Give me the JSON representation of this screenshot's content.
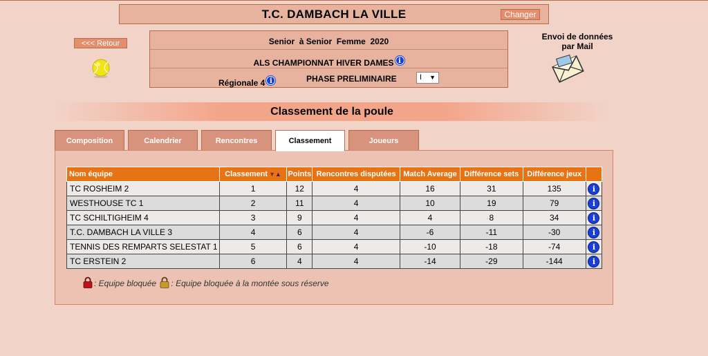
{
  "header": {
    "club_name": "T.C. DAMBACH LA VILLE",
    "change_label": "Changer"
  },
  "nav": {
    "back_label": "<<< Retour"
  },
  "competition": {
    "category": "Senior  à Senior  Femme  2020",
    "championship": "ALS CHAMPIONNAT HIVER DAMES",
    "division": "Régionale 4",
    "phase": "PHASE PRELIMINAIRE",
    "phase_selected": "I"
  },
  "mail": {
    "label_line1": "Envoi de données",
    "label_line2": "par Mail"
  },
  "section": {
    "title": "Classement de la poule"
  },
  "tabs": [
    {
      "label": "Composition",
      "active": false
    },
    {
      "label": "Calendrier",
      "active": false
    },
    {
      "label": "Rencontres",
      "active": false
    },
    {
      "label": "Classement",
      "active": true
    },
    {
      "label": "Joueurs",
      "active": false
    }
  ],
  "table": {
    "columns": [
      "Nom équipe",
      "Classement",
      "Points",
      "Rencontres disputées",
      "Match Average",
      "Différence sets",
      "Différence jeux",
      ""
    ],
    "rows": [
      {
        "team": "TC ROSHEIM 2",
        "rank": "1",
        "points": "12",
        "played": "4",
        "match_avg": "16",
        "diff_sets": "31",
        "diff_games": "135"
      },
      {
        "team": "WESTHOUSE TC 1",
        "rank": "2",
        "points": "11",
        "played": "4",
        "match_avg": "10",
        "diff_sets": "19",
        "diff_games": "79"
      },
      {
        "team": "TC SCHILTIGHEIM 4",
        "rank": "3",
        "points": "9",
        "played": "4",
        "match_avg": "4",
        "diff_sets": "8",
        "diff_games": "34"
      },
      {
        "team": "T.C. DAMBACH LA VILLE 3",
        "rank": "4",
        "points": "6",
        "played": "4",
        "match_avg": "-6",
        "diff_sets": "-11",
        "diff_games": "-30"
      },
      {
        "team": "TENNIS DES REMPARTS SELESTAT 1",
        "rank": "5",
        "points": "6",
        "played": "4",
        "match_avg": "-10",
        "diff_sets": "-18",
        "diff_games": "-74"
      },
      {
        "team": "TC ERSTEIN 2",
        "rank": "6",
        "points": "4",
        "played": "4",
        "match_avg": "-14",
        "diff_sets": "-29",
        "diff_games": "-144"
      }
    ]
  },
  "legend": {
    "blocked": ": Equipe bloquée",
    "blocked_promotion": ": Equipe bloquée à la montée sous réserve"
  },
  "colors": {
    "background": "#f2d3c8",
    "header_orange": "#e77315",
    "info_blue": "#1a3ed8",
    "tab_inactive": "#d8937d"
  },
  "icons": {
    "info": "info-icon",
    "ball": "tennis-ball-icon",
    "mail": "mail-envelope-icon",
    "lock_red": "red-lock-icon",
    "lock_gold": "gold-lock-icon"
  }
}
